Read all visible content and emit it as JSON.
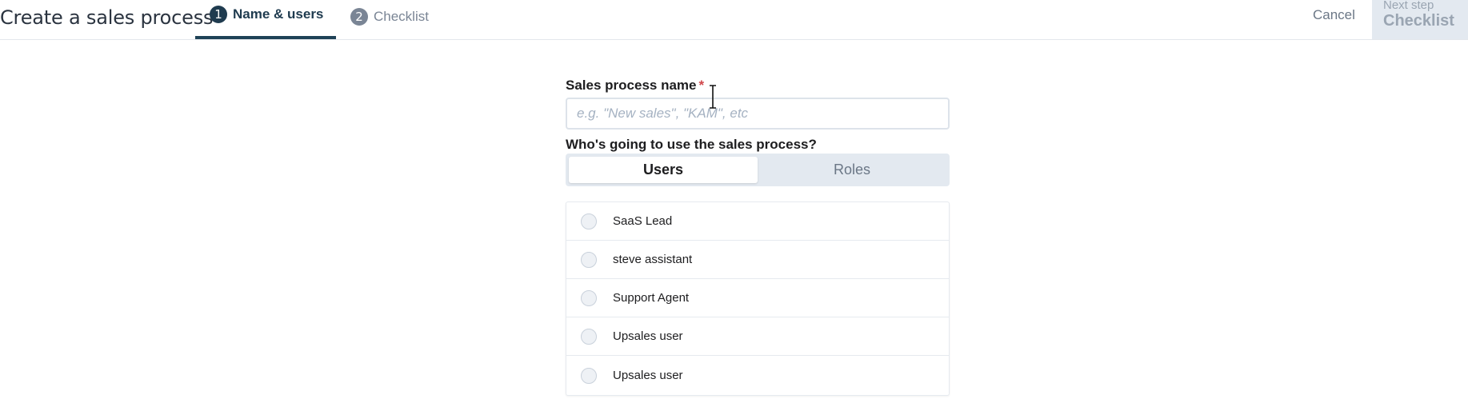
{
  "header": {
    "title": "Create a sales process",
    "steps": [
      {
        "number": "1",
        "label": "Name & users",
        "active": true
      },
      {
        "number": "2",
        "label": "Checklist",
        "active": false
      }
    ],
    "cancel_label": "Cancel",
    "next_step": {
      "caption": "Next step",
      "label": "Checklist"
    }
  },
  "form": {
    "name_label": "Sales process name",
    "required_mark": "*",
    "name_placeholder": "e.g. \"New sales\", \"KAM\", etc",
    "name_value": "",
    "who_label": "Who's going to use the sales process?",
    "toggle": {
      "users": "Users",
      "roles": "Roles",
      "selected": "Users"
    },
    "users": [
      {
        "label": "SaaS Lead",
        "checked": false
      },
      {
        "label": "steve assistant",
        "checked": false
      },
      {
        "label": "Support Agent",
        "checked": false
      },
      {
        "label": "Upsales user",
        "checked": false
      },
      {
        "label": "Upsales user",
        "checked": false
      }
    ]
  },
  "colors": {
    "active_step": "#1f3b4f",
    "inactive_step": "#7a8595",
    "required": "#d0474b",
    "next_button_bg": "#e3e9f0"
  }
}
